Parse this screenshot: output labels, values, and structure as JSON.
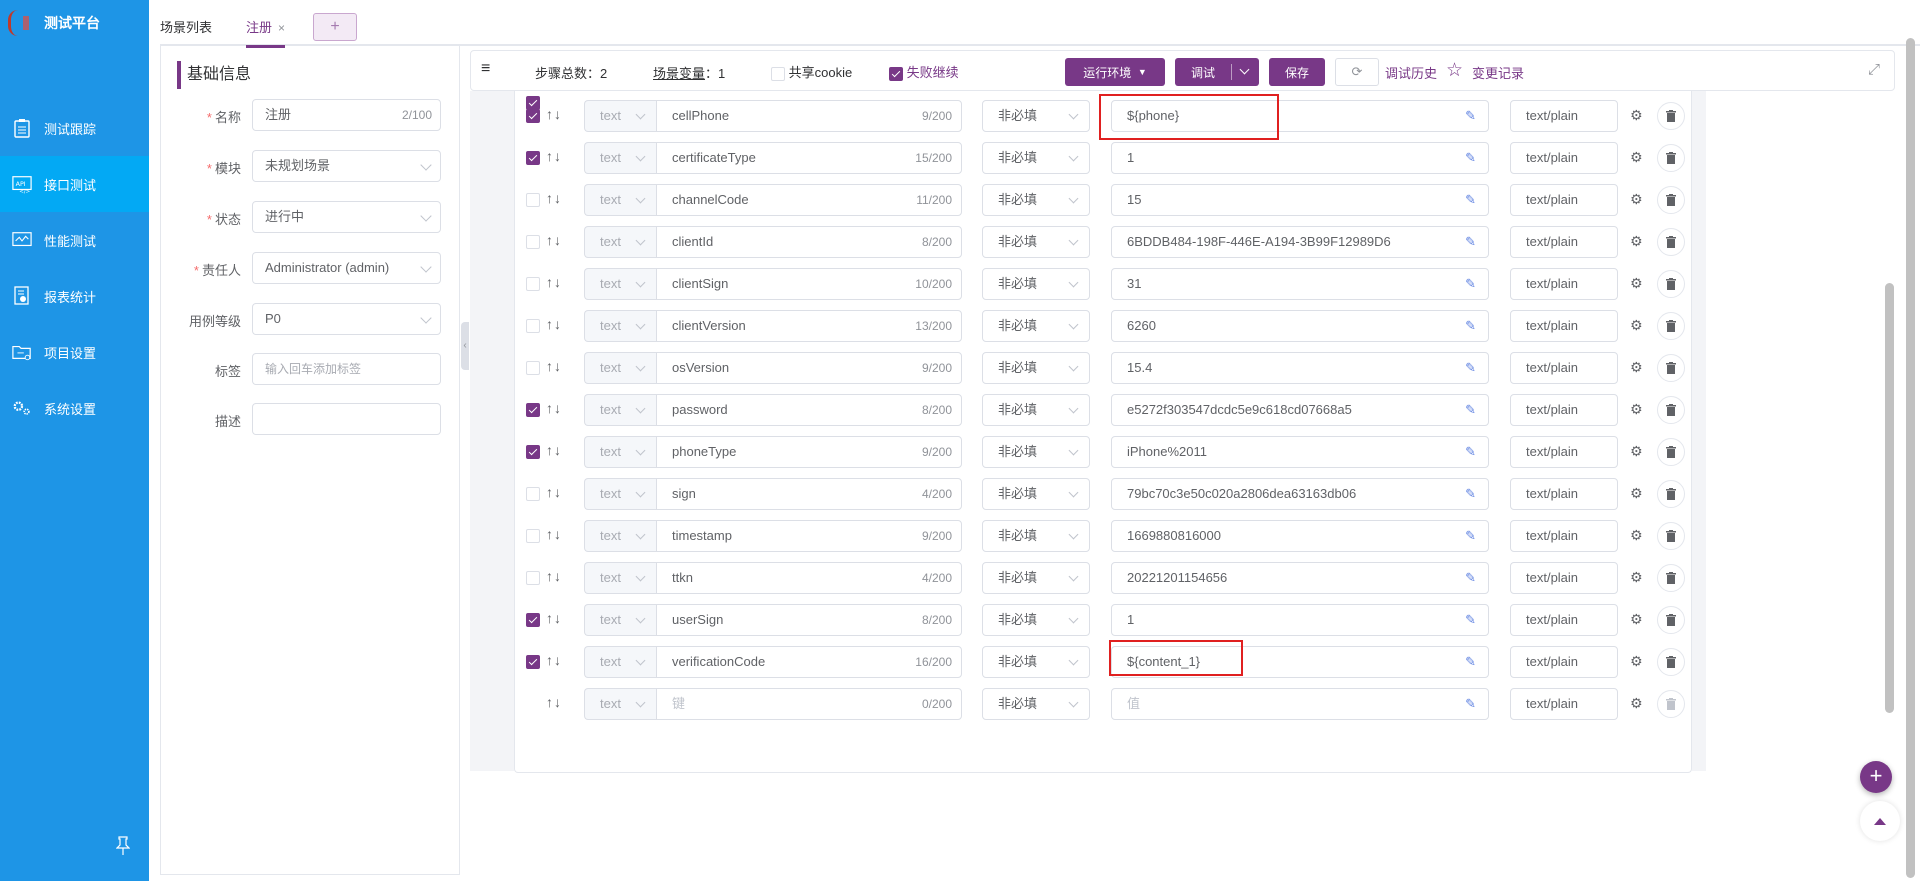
{
  "app": {
    "title": "测试平台"
  },
  "sidebar": {
    "items": [
      {
        "label": "测试跟踪",
        "icon": "clipboard-icon",
        "active": false
      },
      {
        "label": "接口测试",
        "icon": "api-icon",
        "active": true
      },
      {
        "label": "性能测试",
        "icon": "performance-chart-icon",
        "active": false
      },
      {
        "label": "报表统计",
        "icon": "report-icon",
        "active": false
      },
      {
        "label": "项目设置",
        "icon": "folder-settings-icon",
        "active": false
      },
      {
        "label": "系统设置",
        "icon": "gears-icon",
        "active": false
      }
    ],
    "pin_icon": "pin-icon"
  },
  "tabs": {
    "items": [
      {
        "label": "场景列表",
        "active": false
      },
      {
        "label": "注册",
        "active": true,
        "closable": true
      }
    ],
    "close_glyph": "×",
    "add_glyph": "+"
  },
  "info": {
    "title": "基础信息",
    "fields": [
      {
        "label": "名称",
        "required": true,
        "value": "注册",
        "counter": "2/100",
        "type": "input"
      },
      {
        "label": "模块",
        "required": true,
        "value": "未规划场景",
        "type": "select"
      },
      {
        "label": "状态",
        "required": true,
        "value": "进行中",
        "type": "select"
      },
      {
        "label": "责任人",
        "required": true,
        "value": "Administrator (admin)",
        "type": "select"
      },
      {
        "label": "用例等级",
        "required": false,
        "value": "P0",
        "type": "select"
      },
      {
        "label": "标签",
        "required": false,
        "placeholder": "输入回车添加标签",
        "type": "tags"
      },
      {
        "label": "描述",
        "required": false,
        "value": "",
        "type": "textarea"
      }
    ],
    "required_mark": "*"
  },
  "toolbar": {
    "steps_label": "步骤总数",
    "steps_value": "2",
    "vars_label": "场景变量",
    "vars_value": "1",
    "share_cookie_label": "共享cookie",
    "share_cookie_checked": false,
    "continue_on_fail_label": "失败继续",
    "continue_on_fail_checked": true,
    "env_button": "运行环境",
    "debug_button": "调试",
    "save_button": "保存",
    "history_link": "调试历史",
    "changelog_link": "变更记录",
    "separator": "："
  },
  "params": {
    "header_checked": true,
    "rows": [
      {
        "checked": true,
        "type": "text",
        "key": "cellPhone",
        "key_count": "9/200",
        "required": "非必填",
        "value": "${phone}",
        "content_type": "text/plain",
        "highlighted": true
      },
      {
        "checked": true,
        "type": "text",
        "key": "certificateType",
        "key_count": "15/200",
        "required": "非必填",
        "value": "1",
        "content_type": "text/plain"
      },
      {
        "checked": false,
        "type": "text",
        "key": "channelCode",
        "key_count": "11/200",
        "required": "非必填",
        "value": "15",
        "content_type": "text/plain"
      },
      {
        "checked": false,
        "type": "text",
        "key": "clientId",
        "key_count": "8/200",
        "required": "非必填",
        "value": "6BDDB484-198F-446E-A194-3B99F12989D6",
        "content_type": "text/plain"
      },
      {
        "checked": false,
        "type": "text",
        "key": "clientSign",
        "key_count": "10/200",
        "required": "非必填",
        "value": "31",
        "content_type": "text/plain"
      },
      {
        "checked": false,
        "type": "text",
        "key": "clientVersion",
        "key_count": "13/200",
        "required": "非必填",
        "value": "6260",
        "content_type": "text/plain"
      },
      {
        "checked": false,
        "type": "text",
        "key": "osVersion",
        "key_count": "9/200",
        "required": "非必填",
        "value": "15.4",
        "content_type": "text/plain"
      },
      {
        "checked": true,
        "type": "text",
        "key": "password",
        "key_count": "8/200",
        "required": "非必填",
        "value": "e5272f303547dcdc5e9c618cd07668a5",
        "content_type": "text/plain"
      },
      {
        "checked": true,
        "type": "text",
        "key": "phoneType",
        "key_count": "9/200",
        "required": "非必填",
        "value": "iPhone%2011",
        "content_type": "text/plain"
      },
      {
        "checked": false,
        "type": "text",
        "key": "sign",
        "key_count": "4/200",
        "required": "非必填",
        "value": "79bc70c3e50c020a2806dea63163db06",
        "content_type": "text/plain"
      },
      {
        "checked": false,
        "type": "text",
        "key": "timestamp",
        "key_count": "9/200",
        "required": "非必填",
        "value": "1669880816000",
        "content_type": "text/plain"
      },
      {
        "checked": false,
        "type": "text",
        "key": "ttkn",
        "key_count": "4/200",
        "required": "非必填",
        "value": "20221201154656",
        "content_type": "text/plain"
      },
      {
        "checked": true,
        "type": "text",
        "key": "userSign",
        "key_count": "8/200",
        "required": "非必填",
        "value": "1",
        "content_type": "text/plain"
      },
      {
        "checked": true,
        "type": "text",
        "key": "verificationCode",
        "key_count": "16/200",
        "required": "非必填",
        "value": "${content_1}",
        "content_type": "text/plain",
        "highlighted": true
      }
    ],
    "new_row": {
      "type": "text",
      "key_placeholder": "键",
      "key_count": "0/200",
      "required": "非必填",
      "value_placeholder": "值",
      "content_type": "text/plain"
    },
    "arrows": "↑↓"
  },
  "colors": {
    "sidebar": "#1E95E6",
    "sidebar_active": "#03A9F4",
    "primary": "#783887",
    "highlight": "#E02020"
  }
}
